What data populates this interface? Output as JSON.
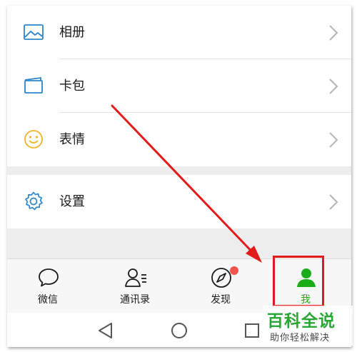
{
  "menu_top": {
    "items": [
      {
        "label": "相册",
        "icon": "photo-album-icon"
      },
      {
        "label": "卡包",
        "icon": "card-wallet-icon"
      },
      {
        "label": "表情",
        "icon": "emoji-smile-icon"
      }
    ]
  },
  "menu_bottom": {
    "items": [
      {
        "label": "设置",
        "icon": "gear-icon"
      }
    ]
  },
  "tabbar": {
    "tabs": [
      {
        "label": "微信",
        "icon": "chat-bubble-icon"
      },
      {
        "label": "通讯录",
        "icon": "contacts-icon"
      },
      {
        "label": "发现",
        "icon": "compass-icon"
      },
      {
        "label": "我",
        "icon": "person-icon"
      }
    ],
    "active_tab": "我",
    "discover_has_badge": true
  },
  "system_nav": {
    "buttons": [
      "back-triangle-icon",
      "home-circle-icon",
      "recents-square-icon"
    ]
  },
  "watermark": {
    "title": "百科全说",
    "subtitle": "助你轻松解决"
  },
  "colors": {
    "accent_blue": "#2b86c9",
    "active_green": "#1aad19",
    "emoji_yellow": "#f0b429",
    "badge_red": "#f2534d",
    "annotation_red": "#e31a1a",
    "watermark_green": "#2aa637"
  }
}
